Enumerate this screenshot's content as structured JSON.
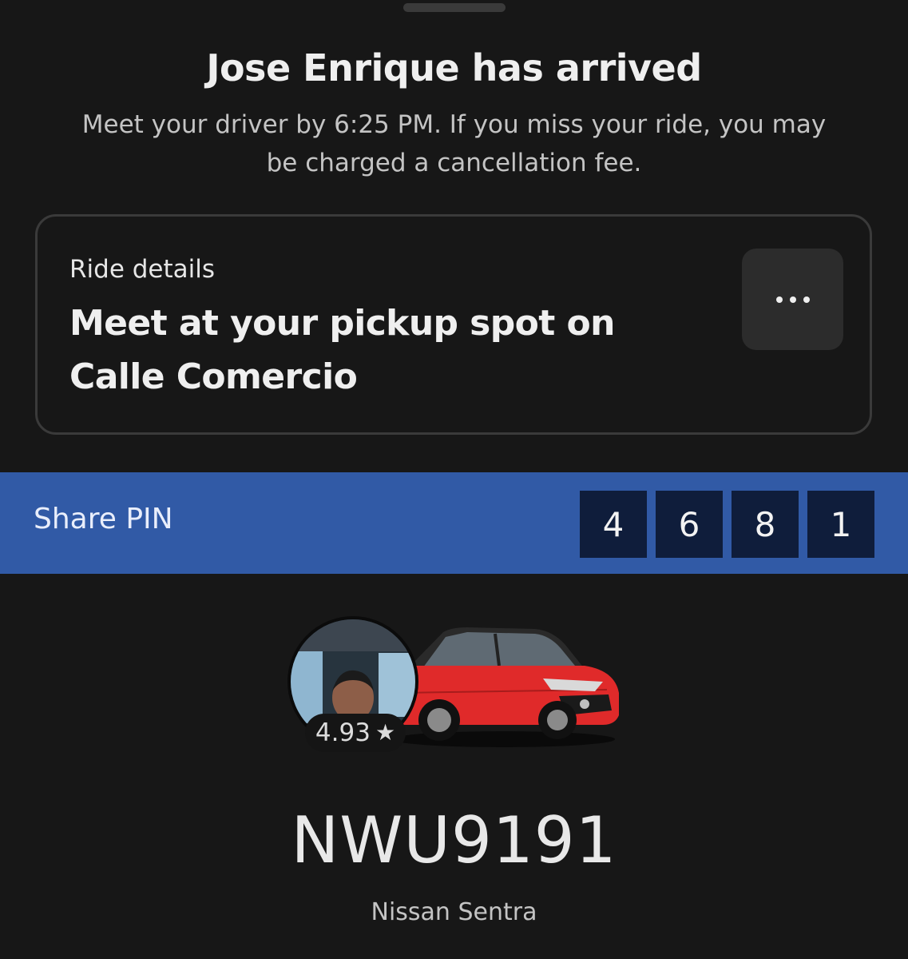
{
  "header": {
    "title": "Jose Enrique has arrived",
    "subtitle": "Meet your driver by 6:25 PM. If you miss your ride, you may be charged a cancellation fee."
  },
  "ride_details": {
    "label": "Ride details",
    "headline": "Meet at your pickup spot on Calle Comercio",
    "more_icon": "more-horizontal-icon"
  },
  "pin": {
    "label": "Share PIN",
    "digits": [
      "4",
      "6",
      "8",
      "1"
    ]
  },
  "driver": {
    "rating": "4.93",
    "rating_icon": "star-icon",
    "car_color": "#e02a2a"
  },
  "vehicle": {
    "plate": "NWU9191",
    "model": "Nissan Sentra"
  }
}
